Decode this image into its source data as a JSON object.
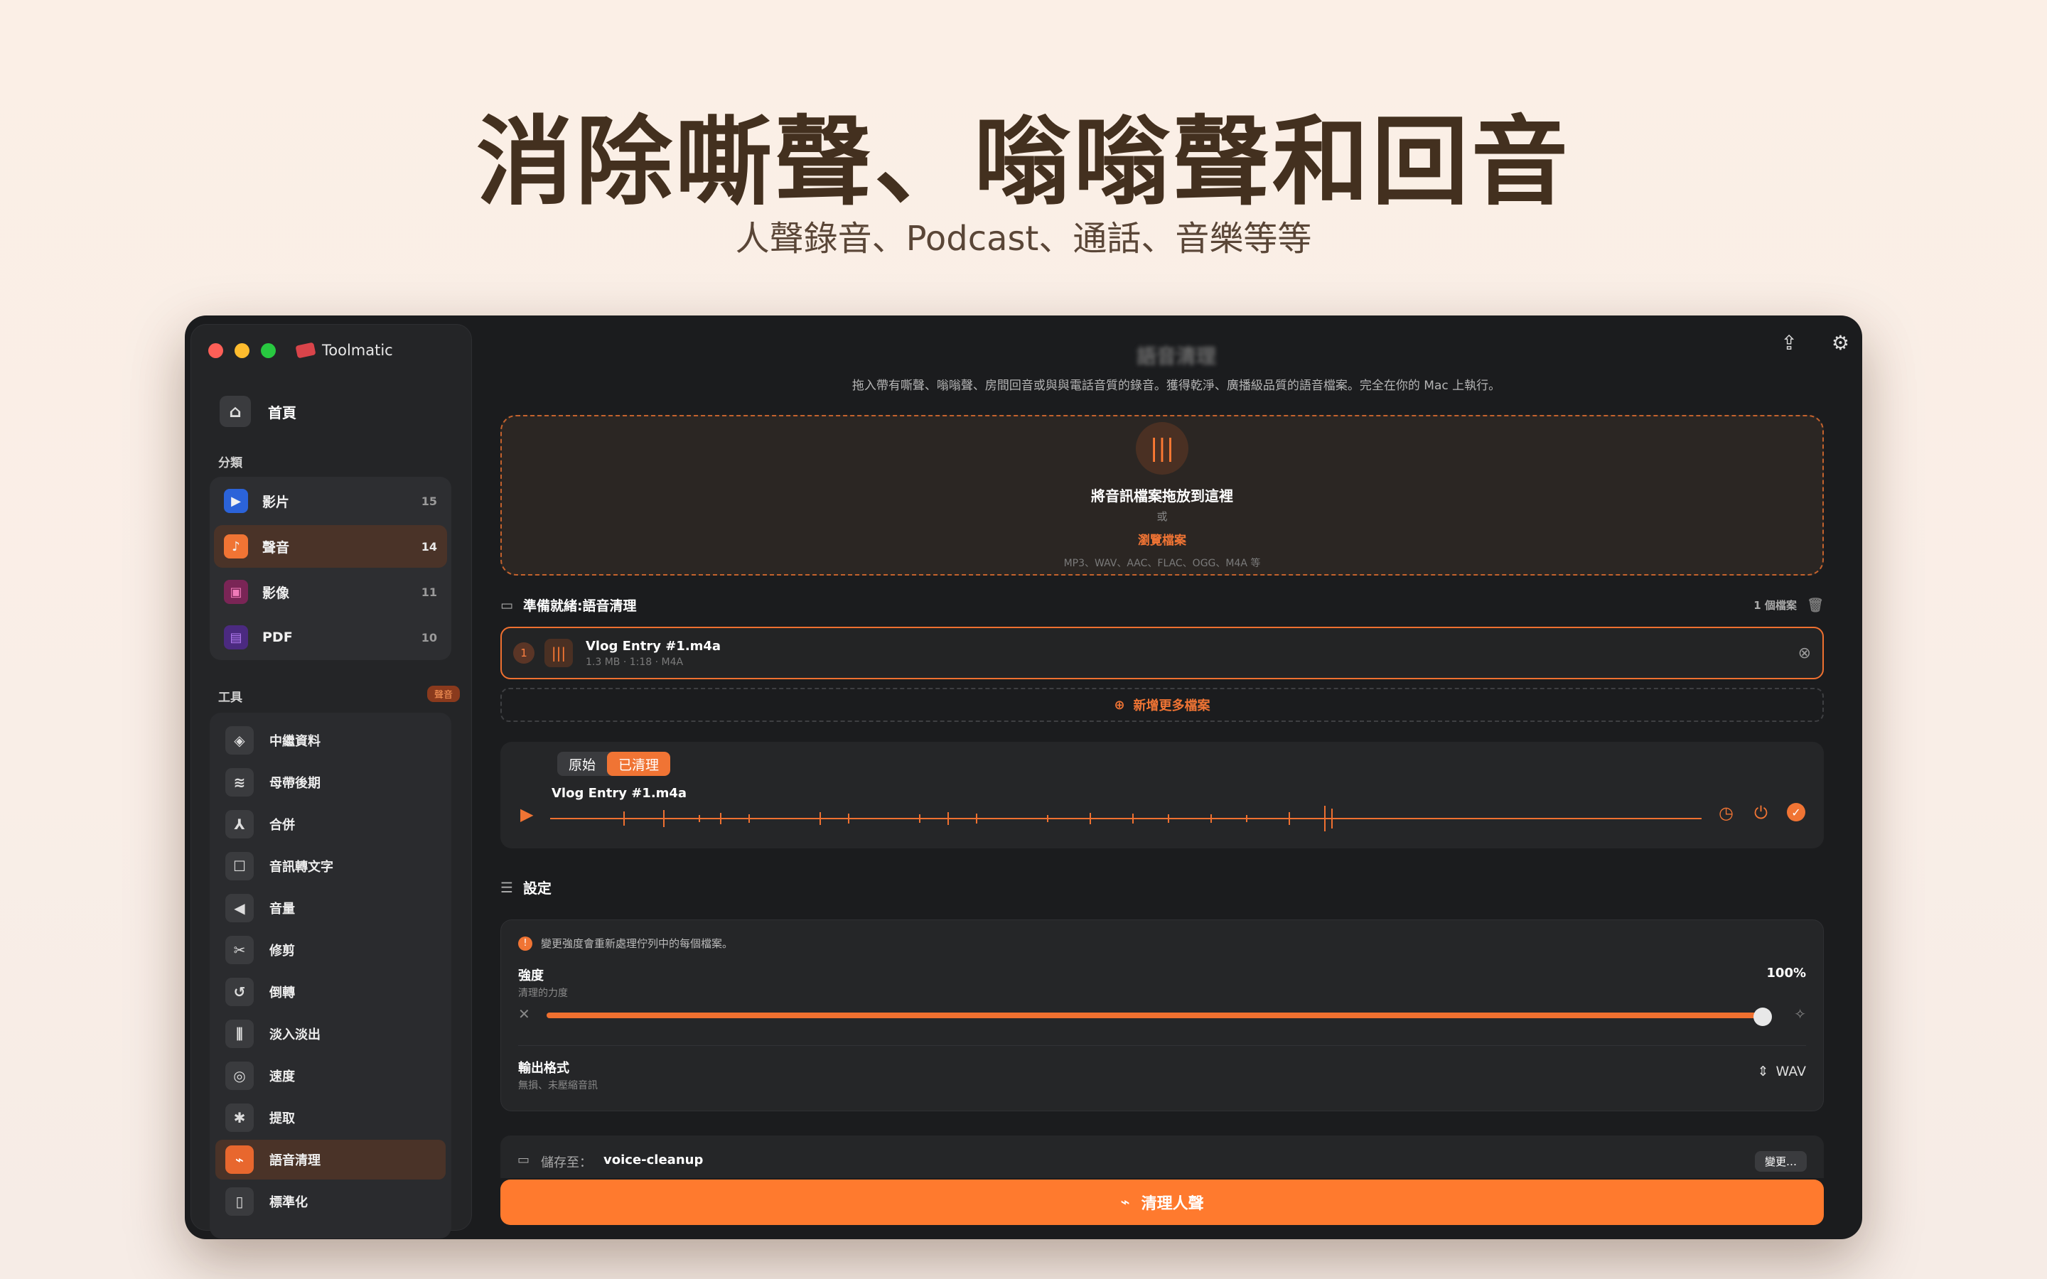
{
  "hero": {
    "title": "消除嘶聲、嗡嗡聲和回音",
    "subtitle": "人聲錄音、Podcast、通話、音樂等等"
  },
  "app": {
    "name": "Toolmatic"
  },
  "sidebar": {
    "home_label": "首頁",
    "categories_label": "分類",
    "categories": [
      {
        "label": "影片",
        "count": "15",
        "color": "#2b63d9"
      },
      {
        "label": "聲音",
        "count": "14",
        "color": "#f07434"
      },
      {
        "label": "影像",
        "count": "11",
        "color": "#c0358a"
      },
      {
        "label": "PDF",
        "count": "10",
        "color": "#7c3ad1"
      }
    ],
    "tools_label": "工具",
    "tools_badge": "聲音",
    "tools": [
      {
        "label": "中繼資料",
        "icon": "tag-icon"
      },
      {
        "label": "母帶後期",
        "icon": "waveform-icon"
      },
      {
        "label": "合併",
        "icon": "merge-icon"
      },
      {
        "label": "音訊轉文字",
        "icon": "transcript-icon"
      },
      {
        "label": "音量",
        "icon": "volume-icon"
      },
      {
        "label": "修剪",
        "icon": "scissors-icon"
      },
      {
        "label": "倒轉",
        "icon": "reverse-icon"
      },
      {
        "label": "淡入淡出",
        "icon": "fade-icon"
      },
      {
        "label": "速度",
        "icon": "speed-icon"
      },
      {
        "label": "提取",
        "icon": "extract-icon"
      },
      {
        "label": "語音清理",
        "icon": "voice-cleanup-icon"
      },
      {
        "label": "標準化",
        "icon": "normalize-icon"
      }
    ]
  },
  "main": {
    "title": "語音清理",
    "description": "拖入帶有嘶聲、嗡嗡聲、房間回音或與與電話音質的錄音。獲得乾淨、廣播級品質的語音檔案。完全在你的 Mac 上執行。",
    "drop": {
      "title": "將音訊檔案拖放到這裡",
      "or": "或",
      "browse": "瀏覽檔案",
      "formats": "MP3、WAV、AAC、FLAC、OGG、M4A 等"
    },
    "queue": {
      "title": "準備就緒:語音清理",
      "count": "1 個檔案"
    },
    "file": {
      "index": "1",
      "name": "Vlog Entry #1.m4a",
      "meta": "1.3 MB · 1:18 · M4A"
    },
    "add_more": "新增更多檔案",
    "player": {
      "original": "原始",
      "cleaned": "已清理",
      "name": "Vlog Entry #1.m4a"
    },
    "settings": {
      "title": "設定",
      "note": "變更強度會重新處理佇列中的每個檔案。",
      "strength_label": "強度",
      "strength_sub": "清理的力度",
      "strength_value": "100%",
      "strength_fraction": 1.0,
      "format_label": "輸出格式",
      "format_sub": "無損、未壓縮音訊",
      "format_value": "WAV"
    },
    "save": {
      "label": "儲存至：",
      "folder": "voice-cleanup",
      "change": "變更…"
    },
    "cta": "清理人聲"
  },
  "colors": {
    "accent": "#ff7a2e",
    "bg": "#1b1c1e"
  }
}
